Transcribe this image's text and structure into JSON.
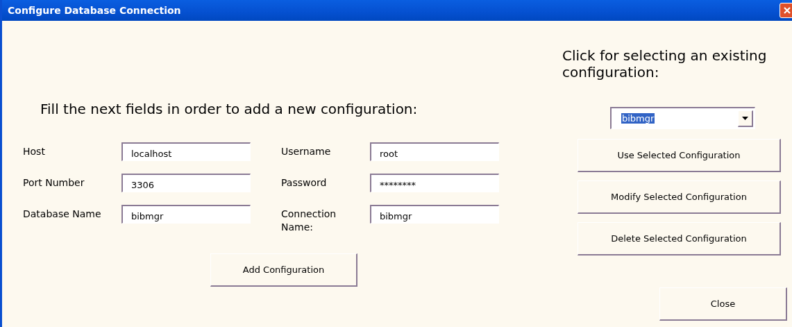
{
  "window": {
    "title": "Configure Database Connection"
  },
  "new_configuration": {
    "heading": "Fill the next fields in order to add a new configuration:",
    "fields": [
      {
        "label": "Host",
        "value": "localhost"
      },
      {
        "label": "Username",
        "value": "root"
      },
      {
        "label": "Port Number",
        "value": "3306"
      },
      {
        "label": "Password",
        "value": "********"
      },
      {
        "label": "Database Name",
        "value": "bibmgr"
      },
      {
        "label": "Connection Name:",
        "value": "bibmgr"
      }
    ],
    "add_button": "Add Configuration"
  },
  "existing_configuration": {
    "heading": "Click for selecting an existing configuration:",
    "dropdown": {
      "value": "bibmgr",
      "highlighted": true
    },
    "buttons": [
      "Use Selected Configuration",
      "Modify Selected Configuration",
      "Delete Selected Configuration"
    ]
  },
  "close_button": "Close"
}
